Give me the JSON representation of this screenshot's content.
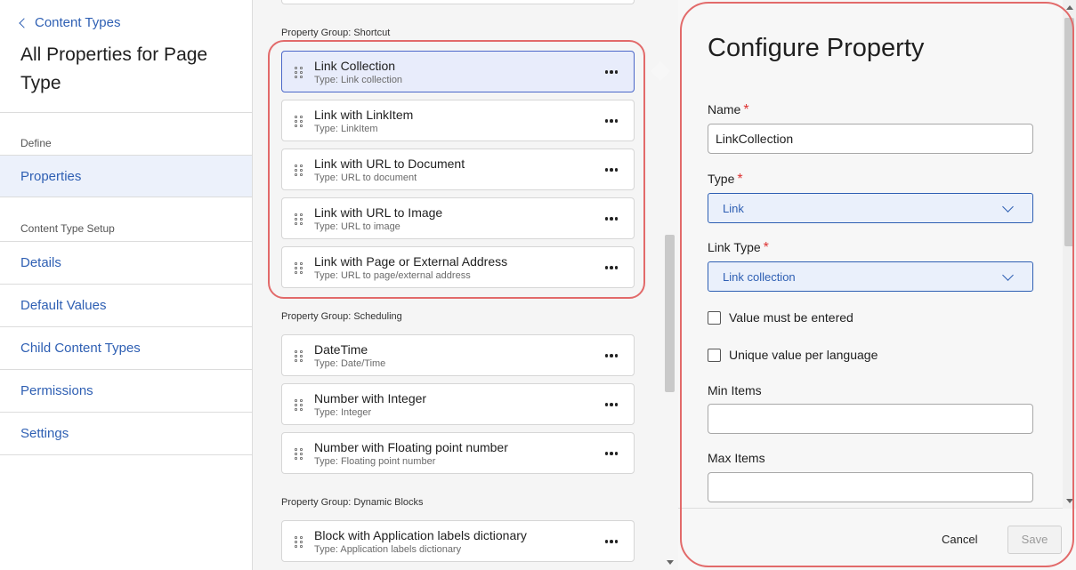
{
  "sidebar": {
    "back_label": "Content Types",
    "page_title": "All Properties for Page Type",
    "define_label": "Define",
    "properties_label": "Properties",
    "setup_label": "Content Type Setup",
    "items": [
      {
        "label": "Details"
      },
      {
        "label": "Default Values"
      },
      {
        "label": "Child Content Types"
      },
      {
        "label": "Permissions"
      },
      {
        "label": "Settings"
      }
    ]
  },
  "groups": [
    {
      "label": "Property Group: Shortcut",
      "properties": [
        {
          "name": "Link Collection",
          "type": "Type: Link collection",
          "selected": true
        },
        {
          "name": "Link with LinkItem",
          "type": "Type: LinkItem"
        },
        {
          "name": "Link with URL to Document",
          "type": "Type: URL to document"
        },
        {
          "name": "Link with URL to Image",
          "type": "Type: URL to image"
        },
        {
          "name": "Link with Page or External Address",
          "type": "Type: URL to page/external address"
        }
      ]
    },
    {
      "label": "Property Group: Scheduling",
      "properties": [
        {
          "name": "DateTime",
          "type": "Type: Date/Time"
        },
        {
          "name": "Number with Integer",
          "type": "Type: Integer"
        },
        {
          "name": "Number with Floating point number",
          "type": "Type: Floating point number"
        }
      ]
    },
    {
      "label": "Property Group: Dynamic Blocks",
      "properties": [
        {
          "name": "Block with Application labels dictionary",
          "type": "Type: Application labels dictionary"
        }
      ]
    }
  ],
  "panel": {
    "title": "Configure Property",
    "name_label": "Name",
    "name_value": "LinkCollection",
    "type_label": "Type",
    "type_value": "Link",
    "link_type_label": "Link Type",
    "link_type_value": "Link collection",
    "required_marker": "*",
    "check_required": "Value must be entered",
    "check_unique": "Unique value per language",
    "min_items_label": "Min Items",
    "min_items_value": "",
    "max_items_label": "Max Items",
    "max_items_value": "",
    "cancel_label": "Cancel",
    "save_label": "Save"
  },
  "colors": {
    "accent": "#2e5fb3",
    "selected_bg": "#e8ecfb",
    "annotation_ring": "#e26a6a",
    "required": "#dd3333"
  }
}
